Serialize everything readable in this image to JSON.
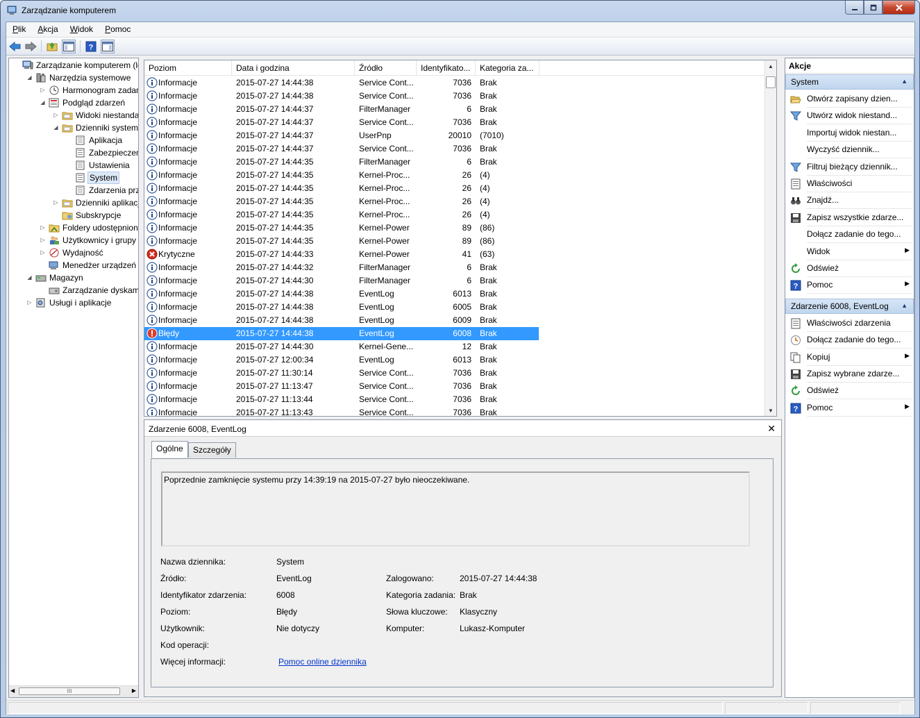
{
  "window": {
    "title": "Zarządzanie komputerem"
  },
  "menu": [
    {
      "label": "Plik",
      "accel": "P",
      "rest": "lik"
    },
    {
      "label": "Akcja",
      "accel": "A",
      "rest": "kcja"
    },
    {
      "label": "Widok",
      "accel": "W",
      "rest": "idok"
    },
    {
      "label": "Pomoc",
      "accel": "P",
      "rest": "omoc"
    }
  ],
  "tree": [
    {
      "label": "Zarządzanie komputerem (lokalny)",
      "icon": "computer-icon",
      "expander": "",
      "depth": 0
    },
    {
      "label": "Narzędzia systemowe",
      "icon": "tools-icon",
      "expander": "open",
      "depth": 1
    },
    {
      "label": "Harmonogram zadań",
      "icon": "clock-icon",
      "expander": "closed",
      "depth": 2
    },
    {
      "label": "Podgląd zdarzeń",
      "icon": "event-viewer-icon",
      "expander": "open",
      "depth": 2
    },
    {
      "label": "Widoki niestandardowe",
      "icon": "folder-icon",
      "expander": "closed",
      "depth": 3
    },
    {
      "label": "Dzienniki systemu Windows",
      "icon": "folder-icon",
      "expander": "open",
      "depth": 3
    },
    {
      "label": "Aplikacja",
      "icon": "log-icon",
      "expander": "",
      "depth": 4
    },
    {
      "label": "Zabezpieczenia",
      "icon": "log-icon",
      "expander": "",
      "depth": 4
    },
    {
      "label": "Ustawienia",
      "icon": "log-icon",
      "expander": "",
      "depth": 4
    },
    {
      "label": "System",
      "icon": "log-icon",
      "expander": "",
      "depth": 4,
      "selected": true
    },
    {
      "label": "Zdarzenia przesyłane dalej",
      "icon": "log-icon",
      "expander": "",
      "depth": 4
    },
    {
      "label": "Dzienniki aplikacji i usług",
      "icon": "folder-icon",
      "expander": "closed",
      "depth": 3
    },
    {
      "label": "Subskrypcje",
      "icon": "subscription-icon",
      "expander": "",
      "depth": 3
    },
    {
      "label": "Foldery udostępnione",
      "icon": "shared-folder-icon",
      "expander": "closed",
      "depth": 2
    },
    {
      "label": "Użytkownicy i grupy lokalne",
      "icon": "users-icon",
      "expander": "closed",
      "depth": 2
    },
    {
      "label": "Wydajność",
      "icon": "performance-icon",
      "expander": "closed",
      "depth": 2
    },
    {
      "label": "Menedżer urządzeń",
      "icon": "device-manager-icon",
      "expander": "",
      "depth": 2
    },
    {
      "label": "Magazyn",
      "icon": "storage-icon",
      "expander": "open",
      "depth": 1
    },
    {
      "label": "Zarządzanie dyskami",
      "icon": "disk-icon",
      "expander": "",
      "depth": 2
    },
    {
      "label": "Usługi i aplikacje",
      "icon": "services-icon",
      "expander": "closed",
      "depth": 1
    }
  ],
  "tree_scroll_label": "III",
  "list": {
    "columns": [
      "Poziom",
      "Data i godzina",
      "Źródło",
      "Identyfikato...",
      "Kategoria za..."
    ],
    "rows": [
      {
        "level": "Informacje",
        "type": "info",
        "date": "2015-07-27 14:44:38",
        "source": "Service Cont...",
        "id": "7036",
        "category": "Brak"
      },
      {
        "level": "Informacje",
        "type": "info",
        "date": "2015-07-27 14:44:38",
        "source": "Service Cont...",
        "id": "7036",
        "category": "Brak"
      },
      {
        "level": "Informacje",
        "type": "info",
        "date": "2015-07-27 14:44:37",
        "source": "FilterManager",
        "id": "6",
        "category": "Brak"
      },
      {
        "level": "Informacje",
        "type": "info",
        "date": "2015-07-27 14:44:37",
        "source": "Service Cont...",
        "id": "7036",
        "category": "Brak"
      },
      {
        "level": "Informacje",
        "type": "info",
        "date": "2015-07-27 14:44:37",
        "source": "UserPnp",
        "id": "20010",
        "category": "(7010)"
      },
      {
        "level": "Informacje",
        "type": "info",
        "date": "2015-07-27 14:44:37",
        "source": "Service Cont...",
        "id": "7036",
        "category": "Brak"
      },
      {
        "level": "Informacje",
        "type": "info",
        "date": "2015-07-27 14:44:35",
        "source": "FilterManager",
        "id": "6",
        "category": "Brak"
      },
      {
        "level": "Informacje",
        "type": "info",
        "date": "2015-07-27 14:44:35",
        "source": "Kernel-Proc...",
        "id": "26",
        "category": "(4)"
      },
      {
        "level": "Informacje",
        "type": "info",
        "date": "2015-07-27 14:44:35",
        "source": "Kernel-Proc...",
        "id": "26",
        "category": "(4)"
      },
      {
        "level": "Informacje",
        "type": "info",
        "date": "2015-07-27 14:44:35",
        "source": "Kernel-Proc...",
        "id": "26",
        "category": "(4)"
      },
      {
        "level": "Informacje",
        "type": "info",
        "date": "2015-07-27 14:44:35",
        "source": "Kernel-Proc...",
        "id": "26",
        "category": "(4)"
      },
      {
        "level": "Informacje",
        "type": "info",
        "date": "2015-07-27 14:44:35",
        "source": "Kernel-Power",
        "id": "89",
        "category": "(86)"
      },
      {
        "level": "Informacje",
        "type": "info",
        "date": "2015-07-27 14:44:35",
        "source": "Kernel-Power",
        "id": "89",
        "category": "(86)"
      },
      {
        "level": "Krytyczne",
        "type": "critical",
        "date": "2015-07-27 14:44:33",
        "source": "Kernel-Power",
        "id": "41",
        "category": "(63)"
      },
      {
        "level": "Informacje",
        "type": "info",
        "date": "2015-07-27 14:44:32",
        "source": "FilterManager",
        "id": "6",
        "category": "Brak"
      },
      {
        "level": "Informacje",
        "type": "info",
        "date": "2015-07-27 14:44:30",
        "source": "FilterManager",
        "id": "6",
        "category": "Brak"
      },
      {
        "level": "Informacje",
        "type": "info",
        "date": "2015-07-27 14:44:38",
        "source": "EventLog",
        "id": "6013",
        "category": "Brak"
      },
      {
        "level": "Informacje",
        "type": "info",
        "date": "2015-07-27 14:44:38",
        "source": "EventLog",
        "id": "6005",
        "category": "Brak"
      },
      {
        "level": "Informacje",
        "type": "info",
        "date": "2015-07-27 14:44:38",
        "source": "EventLog",
        "id": "6009",
        "category": "Brak"
      },
      {
        "level": "Błędy",
        "type": "error",
        "date": "2015-07-27 14:44:38",
        "source": "EventLog",
        "id": "6008",
        "category": "Brak",
        "selected": true
      },
      {
        "level": "Informacje",
        "type": "info",
        "date": "2015-07-27 14:44:30",
        "source": "Kernel-Gene...",
        "id": "12",
        "category": "Brak"
      },
      {
        "level": "Informacje",
        "type": "info",
        "date": "2015-07-27 12:00:34",
        "source": "EventLog",
        "id": "6013",
        "category": "Brak"
      },
      {
        "level": "Informacje",
        "type": "info",
        "date": "2015-07-27 11:30:14",
        "source": "Service Cont...",
        "id": "7036",
        "category": "Brak"
      },
      {
        "level": "Informacje",
        "type": "info",
        "date": "2015-07-27 11:13:47",
        "source": "Service Cont...",
        "id": "7036",
        "category": "Brak"
      },
      {
        "level": "Informacje",
        "type": "info",
        "date": "2015-07-27 11:13:44",
        "source": "Service Cont...",
        "id": "7036",
        "category": "Brak"
      },
      {
        "level": "Informacje",
        "type": "info",
        "date": "2015-07-27 11:13:43",
        "source": "Service Cont...",
        "id": "7036",
        "category": "Brak"
      }
    ]
  },
  "detail": {
    "title": "Zdarzenie 6008, EventLog",
    "tabs": [
      "Ogólne",
      "Szczegóły"
    ],
    "description": "Poprzednie zamknięcie systemu przy 14:39:19 na 2015-07-27 było nieoczekiwane.",
    "labels": {
      "log_name": "Nazwa dziennika:",
      "source": "Źródło:",
      "event_id": "Identyfikator zdarzenia:",
      "level": "Poziom:",
      "user": "Użytkownik:",
      "opcode": "Kod operacji:",
      "more_info": "Więcej informacji:",
      "logged": "Zalogowano:",
      "task_category": "Kategoria zadania:",
      "keywords": "Słowa kluczowe:",
      "computer": "Komputer:"
    },
    "values": {
      "log_name": "System",
      "source": "EventLog",
      "event_id": "6008",
      "level": "Błędy",
      "user": "Nie dotyczy",
      "opcode": "",
      "more_info_link": "Pomoc online dziennika",
      "logged": "2015-07-27 14:44:38",
      "task_category": "Brak",
      "keywords": "Klasyczny",
      "computer": "Lukasz-Komputer"
    }
  },
  "actions": {
    "title": "Akcje",
    "sections": [
      {
        "title": "System",
        "items": [
          {
            "label": "Otwórz zapisany dzien...",
            "icon": "open-folder-icon"
          },
          {
            "label": "Utwórz widok niestand...",
            "icon": "filter-icon"
          },
          {
            "label": "Importuj widok niestan...",
            "icon": ""
          },
          {
            "label": "Wyczyść dziennik...",
            "icon": ""
          },
          {
            "label": "Filtruj bieżący dziennik...",
            "icon": "filter-icon"
          },
          {
            "label": "Właściwości",
            "icon": "properties-icon"
          },
          {
            "label": "Znajdź...",
            "icon": "binoculars-icon"
          },
          {
            "label": "Zapisz wszystkie zdarze...",
            "icon": "save-icon"
          },
          {
            "label": "Dołącz zadanie do tego...",
            "icon": ""
          },
          {
            "label": "Widok",
            "icon": "",
            "submenu": true
          },
          {
            "label": "Odśwież",
            "icon": "refresh-icon"
          },
          {
            "label": "Pomoc",
            "icon": "help-icon",
            "submenu": true
          }
        ]
      },
      {
        "title": "Zdarzenie 6008, EventLog",
        "items": [
          {
            "label": "Właściwości zdarzenia",
            "icon": "properties-icon"
          },
          {
            "label": "Dołącz zadanie do tego...",
            "icon": "task-icon"
          },
          {
            "label": "Kopiuj",
            "icon": "copy-icon",
            "submenu": true
          },
          {
            "label": "Zapisz wybrane zdarze...",
            "icon": "save-icon"
          },
          {
            "label": "Odśwież",
            "icon": "refresh-icon"
          },
          {
            "label": "Pomoc",
            "icon": "help-icon",
            "submenu": true
          }
        ]
      }
    ]
  },
  "colors": {
    "selection": "#3399ff",
    "section_header": "#c8daf0",
    "link": "#0033cc"
  }
}
